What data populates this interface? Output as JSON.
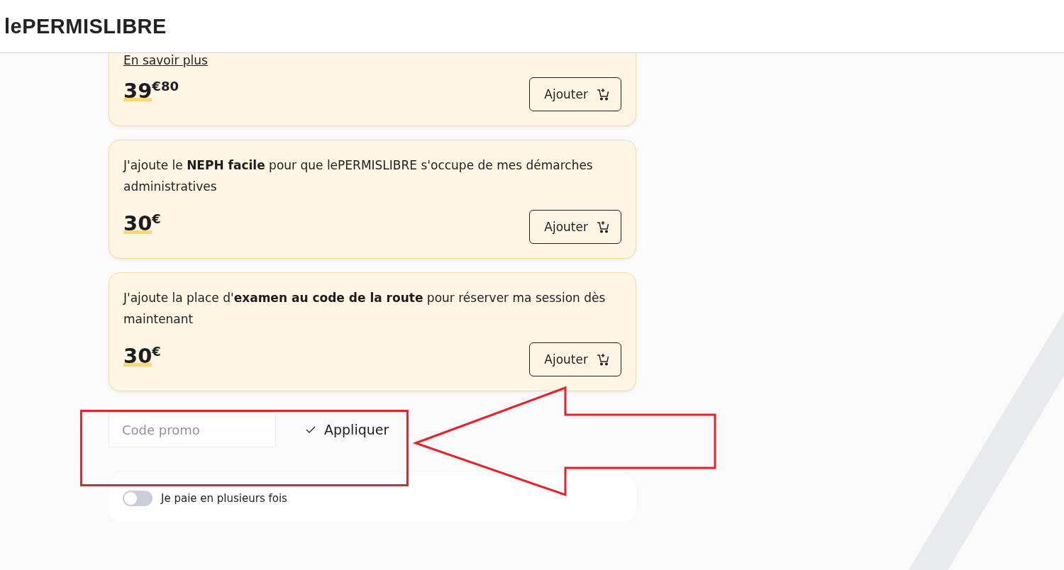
{
  "header": {
    "logo": "lePERMISLIBRE"
  },
  "offers": [
    {
      "kind": "cut",
      "link": "En savoir plus",
      "price": "39",
      "price_sup": "€80",
      "button": "Ajouter"
    },
    {
      "kind": "full",
      "description": "J'ajoute le **NEPH facile** pour que lePERMISLIBRE s'occupe de mes démarches administratives",
      "price": "30",
      "price_sup": "€",
      "button": "Ajouter"
    },
    {
      "kind": "full",
      "description": "J'ajoute la place d'**examen au code de la route** pour réserver ma session dès maintenant",
      "price": "30",
      "price_sup": "€",
      "button": "Ajouter"
    }
  ],
  "promo": {
    "placeholder": "Code promo",
    "apply": "Appliquer"
  },
  "installments": {
    "label": "Je paie en plusieurs fois",
    "on": false
  }
}
